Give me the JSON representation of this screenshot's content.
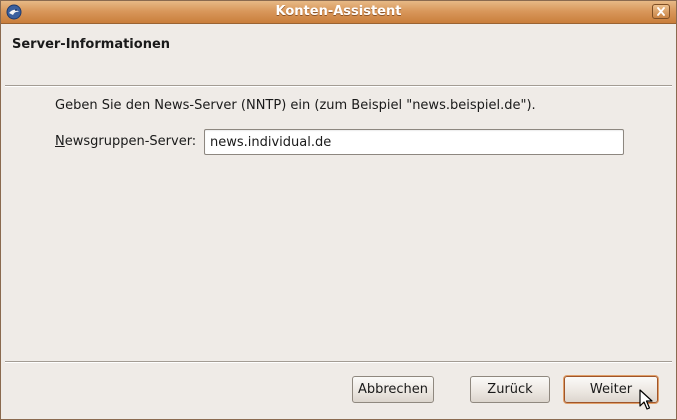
{
  "window": {
    "title": "Konten-Assistent"
  },
  "header": {
    "title": "Server-Informationen"
  },
  "main": {
    "intro_text": "Geben Sie den News-Server (NNTP) ein (zum Beispiel \"news.beispiel.de\").",
    "server_label_mnemonic": "N",
    "server_label_rest": "ewsgruppen-Server:",
    "server_value": "news.individual.de"
  },
  "buttons": {
    "cancel": "Abbrechen",
    "back": "Zurück",
    "next": "Weiter"
  },
  "icons": {
    "app": "thunderbird-icon",
    "close": "close-icon",
    "cursor": "mouse-pointer-icon"
  },
  "colors": {
    "titlebar": "#d9985c",
    "background": "#efebe7",
    "default_button_border": "#a0552a"
  }
}
